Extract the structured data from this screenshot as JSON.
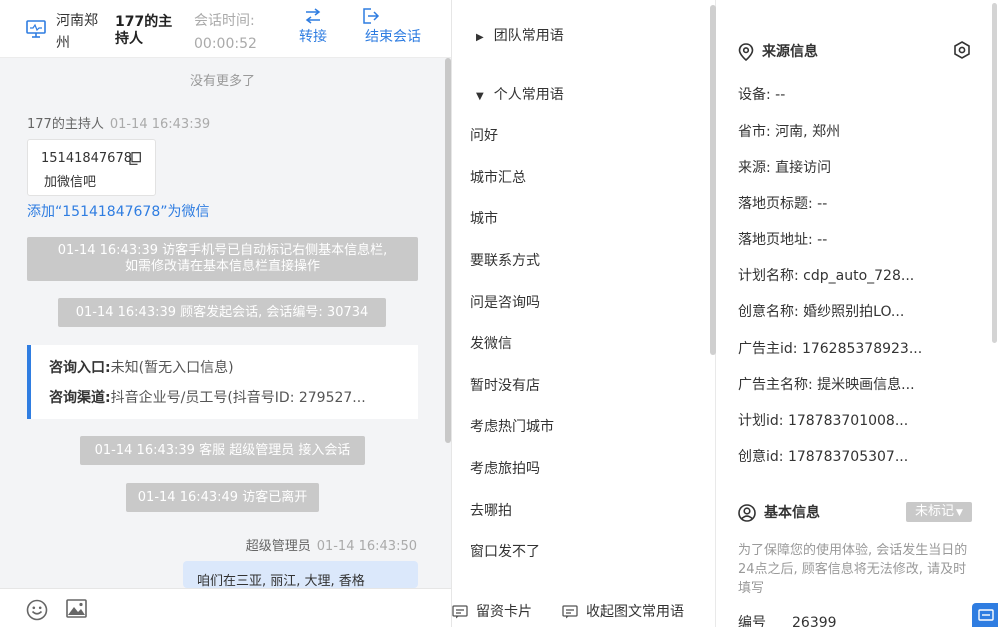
{
  "header": {
    "location": "河南郑州",
    "host_name": "177的主持人",
    "session_label": "会话时间:",
    "session_time": "00:00:52",
    "transfer_label": "转接",
    "end_label": "结束会话",
    "icons": [
      "monitor-icon",
      "swap-icon",
      "exit-icon"
    ]
  },
  "chat": {
    "no_more": "没有更多了",
    "host_sender": "177的主持人",
    "host_time": "01-14 16:43:39",
    "card_number": "15141847678",
    "card_text": "加微信吧",
    "add_wechat": "添加“15141847678”为微信",
    "sys_msg1_line1": "01-14 16:43:39 访客手机号已自动标记右侧基本信息栏,",
    "sys_msg1_line2": "如需修改请在基本信息栏直接操作",
    "sys_msg2": "01-14 16:43:39 顾客发起会话, 会话编号: 30734",
    "consult_entry_label": "咨询入口:",
    "consult_entry_value": "未知(暂无入口信息)",
    "consult_channel_label": "咨询渠道:",
    "consult_channel_value": "抖音企业号/员工号(抖音号ID: 279527...",
    "sys_msg3": "01-14 16:43:39 客服 超级管理员 接入会话",
    "sys_msg4": "01-14 16:43:49 访客已离开",
    "agent_sender": "超级管理员",
    "agent_time": "01-14 16:43:50",
    "agent_message": "咱们在三亚, 丽江, 大理, 香格"
  },
  "phrases": {
    "team_group": "团队常用语",
    "personal_group": "个人常用语",
    "items": [
      "问好",
      "城市汇总",
      "城市",
      "要联系方式",
      "问是咨询吗",
      "发微信",
      "暂时没有店",
      "考虑热门城市",
      "考虑旅拍吗",
      "去哪拍",
      "窗口发不了"
    ],
    "bottom_card": "留资卡片",
    "bottom_collapse": "收起图文常用语"
  },
  "source_info": {
    "title": "来源信息",
    "rows": [
      "设备: --",
      "省市: 河南, 郑州",
      "来源: 直接访问",
      "落地页标题: --",
      "落地页地址: --",
      "计划名称: cdp_auto_728...",
      "创意名称: 婚纱照别拍LO...",
      "广告主id: 176285378923...",
      "广告主名称: 提米映画信息...",
      "计划id: 178783701008...",
      "创意id: 178783705307..."
    ]
  },
  "basic_info": {
    "title": "基本信息",
    "tag": "未标记",
    "notice": "为了保障您的使用体验, 会话发生当日的24点之后, 顾客信息将无法修改, 请及时填写",
    "id_label": "编号",
    "id_value": "26399"
  },
  "colors": {
    "accent": "#2f7de1",
    "system_msg_bg": "#c9c9c9",
    "chat_bg": "#f3f4f6",
    "agent_bubble": "#dbe8fb"
  }
}
